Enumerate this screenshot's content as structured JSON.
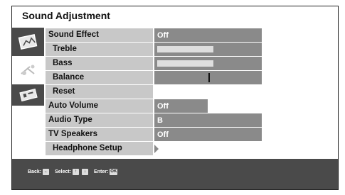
{
  "title": "Sound Adjustment",
  "menu": {
    "sound_effect": {
      "label": "Sound Effect",
      "value": "Off"
    },
    "treble": {
      "label": "Treble",
      "level": 0.55
    },
    "bass": {
      "label": "Bass",
      "level": 0.55
    },
    "balance": {
      "label": "Balance",
      "level": 0.5
    },
    "reset": {
      "label": "Reset"
    },
    "auto_volume": {
      "label": "Auto Volume",
      "value": "Off"
    },
    "audio_type": {
      "label": "Audio Type",
      "value": "B"
    },
    "tv_speakers": {
      "label": "TV Speakers",
      "value": "Off"
    },
    "headphone_setup": {
      "label": "Headphone Setup"
    }
  },
  "help": {
    "back_label": "Back:",
    "back_key": "←",
    "select_label": "Select:",
    "select_up_key": "↑",
    "select_down_key": "↓",
    "enter_label": "Enter:",
    "enter_key": "OK"
  },
  "icons": [
    "picture-settings-icon",
    "sound-settings-icon",
    "setup-settings-icon"
  ]
}
